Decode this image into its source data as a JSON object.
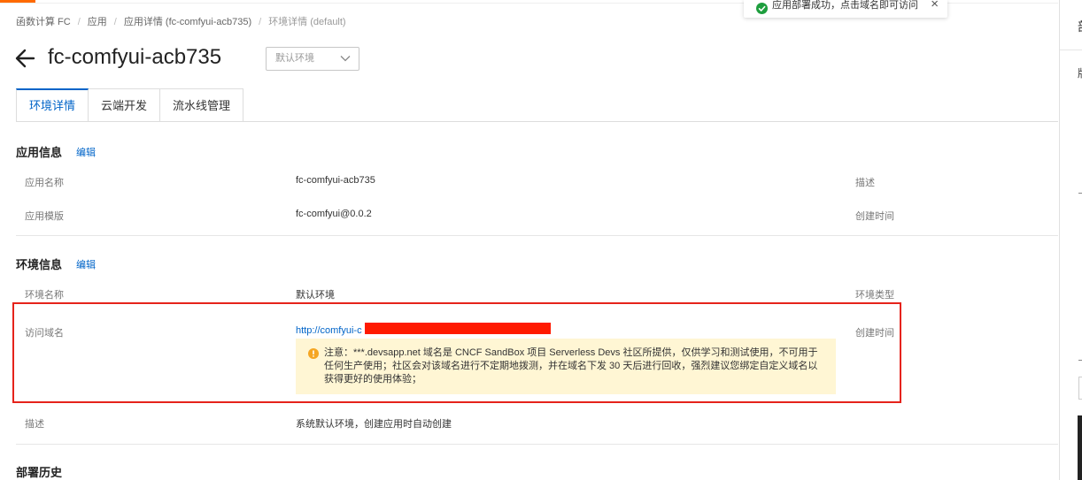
{
  "breadcrumb": [
    "函数计算 FC",
    "应用",
    "应用详情 (fc-comfyui-acb735)",
    "环境详情 (default)"
  ],
  "title": "fc-comfyui-acb735",
  "env_select": {
    "value": "默认环境"
  },
  "tabs": [
    {
      "label": "环境详情",
      "active": true
    },
    {
      "label": "云端开发",
      "active": false
    },
    {
      "label": "流水线管理",
      "active": false
    }
  ],
  "app_info": {
    "title": "应用信息",
    "edit": "编辑",
    "rows": [
      {
        "label": "应用名称",
        "value": "fc-comfyui-acb735",
        "right_label": "描述"
      },
      {
        "label": "应用模版",
        "value": "fc-comfyui@0.0.2",
        "right_label": "创建时间"
      }
    ]
  },
  "env_info": {
    "title": "环境信息",
    "edit": "编辑",
    "name": {
      "label": "环境名称",
      "value": "默认环境",
      "right_label": "环境类型"
    },
    "domain": {
      "label": "访问域名",
      "url": "http://comfyui-c",
      "right_label": "创建时间",
      "notice": "注意：***.devsapp.net 域名是 CNCF SandBox 项目 Serverless Devs 社区所提供，仅供学习和测试使用，不可用于任何生产使用；社区会对该域名进行不定期地拨测，并在域名下发 30 天后进行回收，强烈建议您绑定自定义域名以获得更好的使用体验；"
    },
    "desc": {
      "label": "描述",
      "value": "系统默认环境，创建应用时自动创建"
    }
  },
  "deploy_history": {
    "title": "部署历史"
  },
  "toast": {
    "text": "应用部署成功，点击域名即可访问"
  },
  "right_panel": {
    "chars": [
      "部",
      "版"
    ]
  },
  "colors": {
    "link": "#0064c8",
    "accent": "#ff6a00",
    "success": "#1e9e3e",
    "warning": "#f5a623",
    "highlight": "#e5231b",
    "notice_bg": "#fff6d4"
  }
}
